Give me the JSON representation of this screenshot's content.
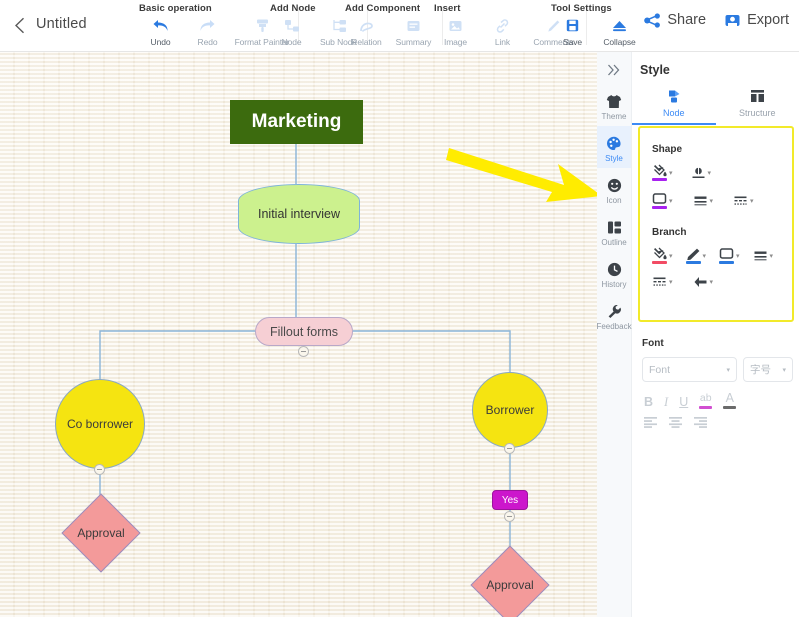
{
  "topbar": {
    "back_icon": "chevron-left-icon",
    "doc_title": "Untitled",
    "groups": [
      {
        "title": "Basic operation",
        "items": [
          {
            "label": "Undo",
            "icon": "undo-arrow-icon",
            "enabled": true
          },
          {
            "label": "Redo",
            "icon": "redo-arrow-icon",
            "enabled": false
          },
          {
            "label": "Format Painter",
            "icon": "format-painter-icon",
            "enabled": false
          }
        ]
      },
      {
        "title": "Add Node",
        "items": [
          {
            "label": "Node",
            "icon": "node-icon",
            "enabled": false
          },
          {
            "label": "Sub Node",
            "icon": "sub-node-icon",
            "enabled": false
          }
        ]
      },
      {
        "title": "Add Component",
        "items": [
          {
            "label": "Relation",
            "icon": "relation-curve-icon",
            "enabled": false
          },
          {
            "label": "Summary",
            "icon": "summary-icon",
            "enabled": false
          }
        ]
      },
      {
        "title": "Insert",
        "items": [
          {
            "label": "Image",
            "icon": "image-icon",
            "enabled": false
          },
          {
            "label": "Link",
            "icon": "link-icon",
            "enabled": false
          },
          {
            "label": "Comments",
            "icon": "comments-pencil-icon",
            "enabled": false
          }
        ]
      },
      {
        "title": "Tool Settings",
        "items": [
          {
            "label": "Save",
            "icon": "save-disk-icon",
            "enabled": true
          },
          {
            "label": "Collapse",
            "icon": "collapse-icon",
            "enabled": true
          }
        ]
      }
    ],
    "actions": [
      {
        "label": "Share",
        "icon": "share-nodes-icon"
      },
      {
        "label": "Export",
        "icon": "export-folder-icon"
      }
    ]
  },
  "canvas": {
    "nodes": [
      {
        "id": "marketing",
        "label": "Marketing",
        "shape": "rectangle",
        "fill": "#3c6b0e",
        "text_color": "#ffffff"
      },
      {
        "id": "initial",
        "label": "Initial interview",
        "shape": "lens",
        "fill": "#ccf18e",
        "text_color": "#333333"
      },
      {
        "id": "fillout",
        "label": "Fillout forms",
        "shape": "pill",
        "fill": "#f6cfd4",
        "text_color": "#4a4a4a"
      },
      {
        "id": "coborrower",
        "label": "Co borrower",
        "shape": "circle",
        "fill": "#f5e411",
        "text_color": "#3b3b3b"
      },
      {
        "id": "borrower",
        "label": "Borrower",
        "shape": "circle",
        "fill": "#f5e411",
        "text_color": "#3b3b3b"
      },
      {
        "id": "yes",
        "label": "Yes",
        "shape": "rounded",
        "fill": "#cc16cc",
        "text_color": "#ffffff"
      },
      {
        "id": "approval-left",
        "label": "Approval",
        "shape": "diamond",
        "fill": "#f39a9a",
        "text_color": "#3b3b3b"
      },
      {
        "id": "approval-right",
        "label": "Approval",
        "shape": "diamond",
        "fill": "#f39a9a",
        "text_color": "#3b3b3b"
      }
    ],
    "link_color": "#8ab4d8",
    "annotation_arrow_color": "#ffec00"
  },
  "rail": {
    "toggle_icon": "chevrons-right-icon",
    "items": [
      {
        "label": "Theme",
        "icon": "tshirt-icon",
        "active": false
      },
      {
        "label": "Style",
        "icon": "palette-icon",
        "active": true
      },
      {
        "label": "Icon",
        "icon": "smiley-icon",
        "active": false
      },
      {
        "label": "Outline",
        "icon": "outline-icon",
        "active": false
      },
      {
        "label": "History",
        "icon": "clock-icon",
        "active": false
      },
      {
        "label": "Feedback",
        "icon": "wrench-icon",
        "active": false
      }
    ]
  },
  "panel": {
    "title": "Style",
    "tabs": [
      {
        "label": "Node",
        "icon": "node-style-icon",
        "active": true
      },
      {
        "label": "Structure",
        "icon": "structure-grid-icon",
        "active": false
      }
    ],
    "shape_section": {
      "label": "Shape",
      "controls": [
        {
          "icon": "fill-bucket-icon",
          "swatch": "#a822f0"
        },
        {
          "icon": "border-color-icon",
          "swatch": null
        },
        {
          "icon": "shape-picker-icon",
          "swatch": "#a822f0"
        },
        {
          "icon": "border-width-icon",
          "swatch": null
        },
        {
          "icon": "border-style-icon",
          "swatch": null
        }
      ]
    },
    "branch_section": {
      "label": "Branch",
      "controls": [
        {
          "icon": "branch-fill-icon",
          "swatch": "#f24b64"
        },
        {
          "icon": "branch-pen-icon",
          "swatch": "#2b7ae0"
        },
        {
          "icon": "branch-shape-icon",
          "swatch": "#2b7ae0"
        },
        {
          "icon": "branch-width-icon",
          "swatch": null
        },
        {
          "icon": "branch-style-icon",
          "swatch": null
        },
        {
          "icon": "branch-arrow-icon",
          "swatch": null
        }
      ]
    },
    "font_section": {
      "label": "Font",
      "family_value": "Font",
      "size_value": "字号",
      "format_buttons": [
        {
          "icon": "bold-icon",
          "glyph": "B",
          "underline": null
        },
        {
          "icon": "italic-icon",
          "glyph": "I",
          "underline": null
        },
        {
          "icon": "underline-icon",
          "glyph": "U",
          "underline": null
        },
        {
          "icon": "highlight-icon",
          "glyph": "ab",
          "underline": "#d14fd1"
        },
        {
          "icon": "font-color-icon",
          "glyph": "A",
          "underline": "#6b6b6b"
        }
      ],
      "align_buttons": [
        {
          "icon": "align-left-icon"
        },
        {
          "icon": "align-center-icon"
        },
        {
          "icon": "align-right-icon"
        }
      ]
    }
  }
}
